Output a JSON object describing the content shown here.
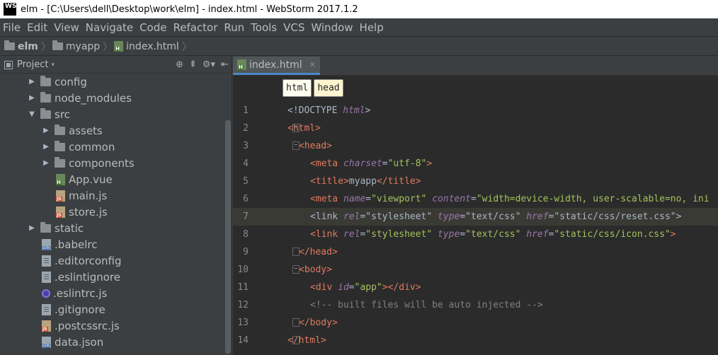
{
  "window": {
    "logo": "WS",
    "title": "elm - [C:\\Users\\dell\\Desktop\\work\\elm] - index.html - WebStorm 2017.1.2"
  },
  "menu": {
    "items": [
      "File",
      "Edit",
      "View",
      "Navigate",
      "Code",
      "Refactor",
      "Run",
      "Tools",
      "VCS",
      "Window",
      "Help"
    ]
  },
  "breadcrumb": {
    "root": "elm",
    "folder": "myapp",
    "file": "index.html"
  },
  "project_panel": {
    "title": "Project",
    "items": [
      {
        "label": "config",
        "type": "folder",
        "expanded": false,
        "depth": 1
      },
      {
        "label": "node_modules",
        "type": "folder",
        "expanded": false,
        "depth": 1
      },
      {
        "label": "src",
        "type": "folder",
        "expanded": true,
        "depth": 1
      },
      {
        "label": "assets",
        "type": "folder",
        "expanded": false,
        "depth": 2
      },
      {
        "label": "common",
        "type": "folder",
        "expanded": false,
        "depth": 2
      },
      {
        "label": "components",
        "type": "folder",
        "expanded": false,
        "depth": 2
      },
      {
        "label": "App.vue",
        "type": "vue",
        "depth": 2
      },
      {
        "label": "main.js",
        "type": "js",
        "depth": 2
      },
      {
        "label": "store.js",
        "type": "js",
        "depth": 2
      },
      {
        "label": "static",
        "type": "folder",
        "expanded": false,
        "depth": 1
      },
      {
        "label": ".babelrc",
        "type": "json",
        "depth": 1
      },
      {
        "label": ".editorconfig",
        "type": "txt",
        "depth": 1
      },
      {
        "label": ".eslintignore",
        "type": "txt",
        "depth": 1
      },
      {
        "label": ".eslintrc.js",
        "type": "eslint",
        "depth": 1
      },
      {
        "label": ".gitignore",
        "type": "txt",
        "depth": 1
      },
      {
        "label": ".postcssrc.js",
        "type": "js",
        "depth": 1
      },
      {
        "label": "data.json",
        "type": "json",
        "depth": 1
      }
    ]
  },
  "editor": {
    "tab_label": "index.html",
    "tag_breadcrumbs": [
      "html",
      "head"
    ],
    "highlighted_line": 7,
    "lines": [
      {
        "n": "1"
      },
      {
        "n": "2"
      },
      {
        "n": "3"
      },
      {
        "n": "4"
      },
      {
        "n": "5"
      },
      {
        "n": "6"
      },
      {
        "n": "7"
      },
      {
        "n": "8"
      },
      {
        "n": "9"
      },
      {
        "n": "10"
      },
      {
        "n": "11"
      },
      {
        "n": "12"
      },
      {
        "n": "13"
      },
      {
        "n": "14"
      }
    ],
    "code": {
      "l1_doctype": "<!DOCTYPE ",
      "l1_html": "html",
      "l1_end": ">",
      "l2": "<html>",
      "l3": "<head>",
      "l4_open": "<meta ",
      "l4_attr": "charset",
      "l4_eq": "=",
      "l4_val": "\"utf-8\"",
      "l4_close": ">",
      "l5_open": "<title>",
      "l5_text": "myapp",
      "l5_close": "</title>",
      "l6_open": "<meta ",
      "l6_attr1": "name",
      "l6_eq": "=",
      "l6_val1": "\"viewport\"",
      "l6_attr2": "content",
      "l6_val2": "\"width=device-width, user-scalable=no, ini",
      "l7_open": "<link ",
      "l7_attr1": "rel",
      "l7_val1": "\"stylesheet\"",
      "l7_attr2": "type",
      "l7_val2": "\"text/css\"",
      "l7_attr3": "href",
      "l7_val3": "\"static/css/reset.css\"",
      "l7_close": ">",
      "l8_open": "<link ",
      "l8_attr1": "rel",
      "l8_val1": "\"stylesheet\"",
      "l8_attr2": "type",
      "l8_val2": "\"text/css\"",
      "l8_attr3": "href",
      "l8_val3": "\"static/css/icon.css\"",
      "l8_close": ">",
      "l9": "</head>",
      "l10": "<body>",
      "l11_open": "<div ",
      "l11_attr": "id",
      "l11_val": "\"app\"",
      "l11_close": "></div>",
      "l12": "<!-- built files will be auto injected -->",
      "l13": "</body>",
      "l14": "</html>"
    }
  }
}
